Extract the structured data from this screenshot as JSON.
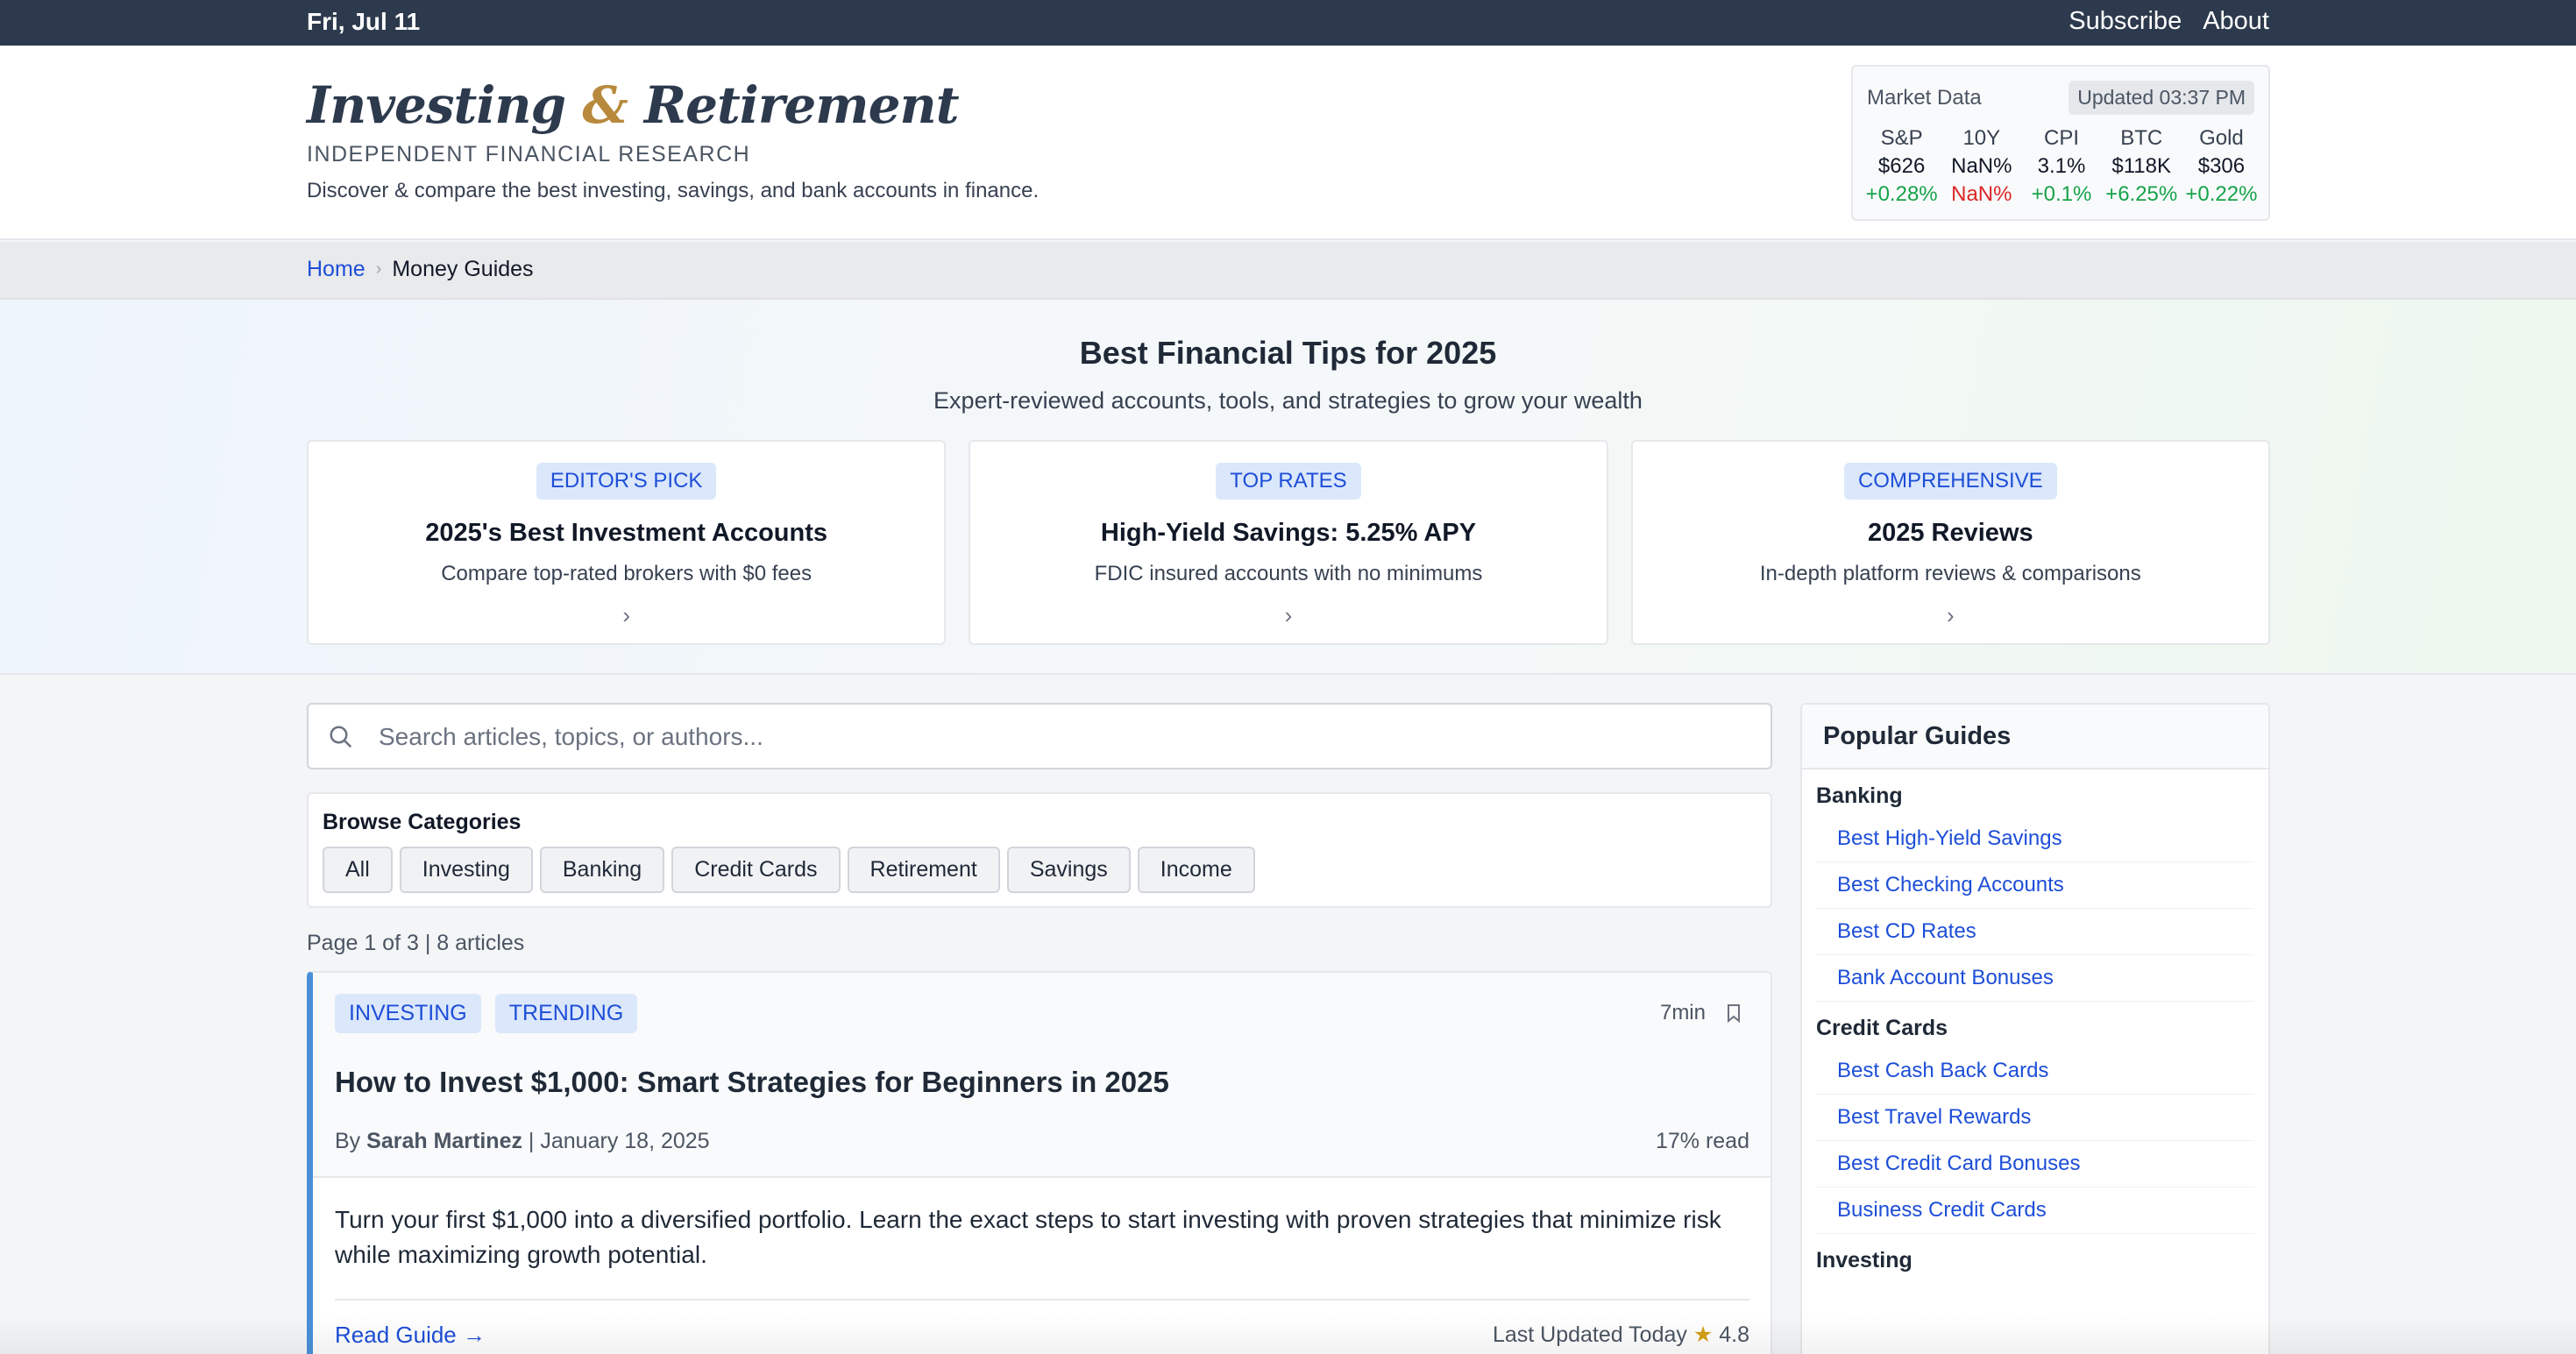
{
  "topbar": {
    "date": "Fri, Jul 11",
    "links": [
      "Subscribe",
      "About"
    ]
  },
  "header": {
    "brand_part1": "Investing",
    "brand_amp": "&",
    "brand_part2": "Retirement",
    "tagline": "INDEPENDENT FINANCIAL RESEARCH",
    "description": "Discover & compare the best investing, savings, and bank accounts in finance."
  },
  "market": {
    "title": "Market Data",
    "updated": "Updated 03:37 PM",
    "items": [
      {
        "label": "S&P",
        "value": "$626",
        "change": "+0.28%",
        "direction": "up"
      },
      {
        "label": "10Y",
        "value": "NaN%",
        "change": "NaN%",
        "direction": "down"
      },
      {
        "label": "CPI",
        "value": "3.1%",
        "change": "+0.1%",
        "direction": "up"
      },
      {
        "label": "BTC",
        "value": "$118K",
        "change": "+6.25%",
        "direction": "up"
      },
      {
        "label": "Gold",
        "value": "$306",
        "change": "+0.22%",
        "direction": "up"
      }
    ],
    "colors": {
      "up": "#16a34a",
      "down": "#dc2626"
    }
  },
  "breadcrumb": {
    "home": "Home",
    "separator": "›",
    "current": "Money Guides"
  },
  "hero": {
    "title": "Best Financial Tips for 2025",
    "subtitle": "Expert-reviewed accounts, tools, and strategies to grow your wealth",
    "cards": [
      {
        "badge": "EDITOR'S PICK",
        "title": "2025's Best Investment Accounts",
        "subtitle": "Compare top-rated brokers with $0 fees",
        "chevron": "›"
      },
      {
        "badge": "TOP RATES",
        "title": "High-Yield Savings: 5.25% APY",
        "subtitle": "FDIC insured accounts with no minimums",
        "chevron": "›"
      },
      {
        "badge": "COMPREHENSIVE",
        "title": "2025 Reviews",
        "subtitle": "In-depth platform reviews & comparisons",
        "chevron": "›"
      }
    ]
  },
  "search": {
    "placeholder": "Search articles, topics, or authors...",
    "value": "",
    "icon": "search-icon"
  },
  "categories": {
    "title": "Browse Categories",
    "items": [
      "All",
      "Investing",
      "Banking",
      "Credit Cards",
      "Retirement",
      "Savings",
      "Income"
    ]
  },
  "page_info": "Page 1 of 3 | 8 articles",
  "article": {
    "tags": [
      "INVESTING",
      "TRENDING"
    ],
    "read_time": "7min",
    "title": "How to Invest $1,000: Smart Strategies for Beginners in 2025",
    "by": "By",
    "author": "Sarah Martinez",
    "date_sep": " | ",
    "date": "January 18, 2025",
    "read_progress": "17% read",
    "excerpt": "Turn your first $1,000 into a diversified portfolio. Learn the exact steps to start investing with proven strategies that minimize risk while maximizing growth potential.",
    "read_link": "Read Guide →",
    "last_updated": "Last Updated Today",
    "star": "★",
    "rating": "4.8"
  },
  "sidebar": {
    "title": "Popular Guides",
    "groups": [
      {
        "title": "Banking",
        "links": [
          "Best High-Yield Savings",
          "Best Checking Accounts",
          "Best CD Rates",
          "Bank Account Bonuses"
        ]
      },
      {
        "title": "Credit Cards",
        "links": [
          "Best Cash Back Cards",
          "Best Travel Rewards",
          "Best Credit Card Bonuses",
          "Business Credit Cards"
        ]
      },
      {
        "title": "Investing",
        "links": []
      }
    ]
  }
}
